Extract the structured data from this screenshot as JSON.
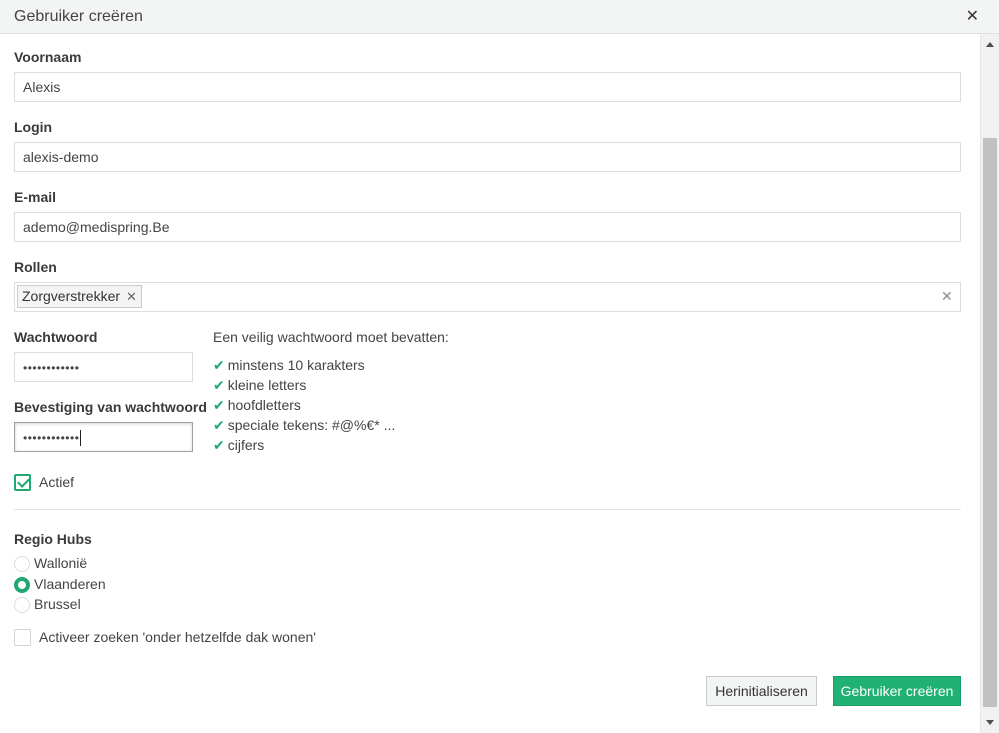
{
  "dialog": {
    "title": "Gebruiker creëren",
    "close_icon": "✕"
  },
  "form": {
    "first_name": {
      "label": "Voornaam",
      "value": "Alexis"
    },
    "login": {
      "label": "Login",
      "value": "alexis-demo"
    },
    "email": {
      "label": "E-mail",
      "value": "ademo@medispring.Be"
    },
    "roles": {
      "label": "Rollen",
      "tags": [
        "Zorgverstrekker"
      ],
      "tag_remove_icon": "✕",
      "clear_icon": "✕"
    },
    "password": {
      "label": "Wachtwoord",
      "value": "••••••••••••"
    },
    "password_confirm": {
      "label": "Bevestiging van wachtwoord",
      "value": "••••••••••••"
    },
    "requirements": {
      "title": "Een veilig wachtwoord moet bevatten:",
      "check_icon": "✔",
      "items": [
        "minstens 10 karakters",
        "kleine letters",
        "hoofdletters",
        "speciale tekens: #@%€* ...",
        "cijfers"
      ]
    },
    "active": {
      "label": "Actief",
      "checked": true
    },
    "region_hubs": {
      "label": "Regio Hubs",
      "options": [
        "Wallonië",
        "Vlaanderen",
        "Brussel"
      ],
      "selected": "Vlaanderen"
    },
    "cohabitation_search": {
      "label": "Activeer zoeken 'onder hetzelfde dak wonen'",
      "checked": false
    }
  },
  "buttons": {
    "reset": "Herinitialiseren",
    "create": "Gebruiker creëren"
  },
  "colors": {
    "accent": "#1fb274",
    "check": "#1fa870"
  }
}
